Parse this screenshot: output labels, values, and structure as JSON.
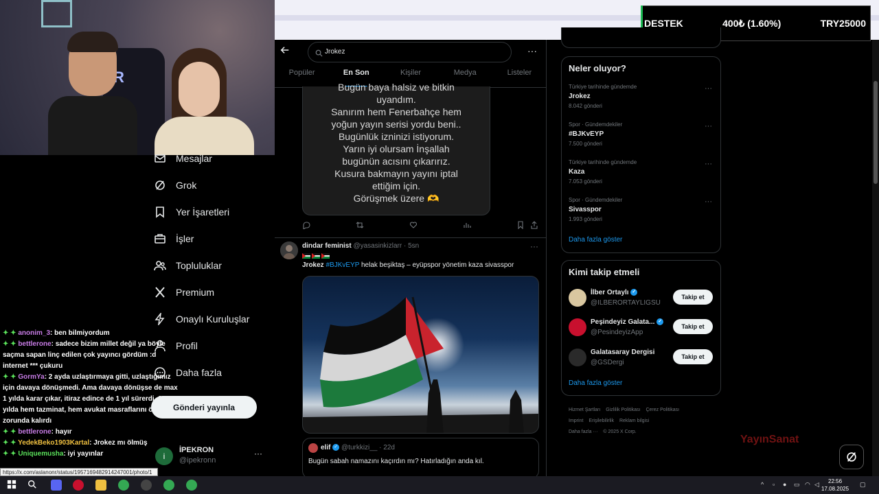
{
  "overlay": {
    "ticker": {
      "label": "DESTEK",
      "change": "400₺ (1.60%)",
      "goal": "TRY25000"
    }
  },
  "chat": {
    "lines": [
      {
        "user": "anonim_3",
        "msg": ": ben bilmiyordum"
      },
      {
        "user": "bettlerone",
        "msg": ": sadece bizim millet değil ya böyle saçma sapan linç edilen çok yayıncı gördüm :d internet *** çukuru"
      },
      {
        "user": "GormYa",
        "msg": ": 2 ayda uzlaştırmaya gitti, uzlaştığımız için davaya dönüşmedi. Ama davaya dönüşse de max 1 yılda karar çıkar, itiraz edince de 1 yıl sürerdi. 2 yılda hem tazminat, hem avukat masraflarını ödemek zorunda kalırdı"
      },
      {
        "user": "bettlerone",
        "msg": ": hayır"
      },
      {
        "user": "YedekBeko1903Kartal",
        "msg": ": Jrokez mı ölmüş"
      },
      {
        "user": "Uniquemusha",
        "msg": ": iyi yayınlar"
      }
    ],
    "link_tooltip": "https://x.com/aslanonr/status/1957169482914247001/photo/1"
  },
  "nav": {
    "items": [
      {
        "label": "Mesajlar",
        "icon": "mail-icon"
      },
      {
        "label": "Grok",
        "icon": "grok-icon"
      },
      {
        "label": "Yer İşaretleri",
        "icon": "bookmark-icon"
      },
      {
        "label": "İşler",
        "icon": "briefcase-icon"
      },
      {
        "label": "Topluluklar",
        "icon": "communities-icon"
      },
      {
        "label": "Premium",
        "icon": "x-logo-icon"
      },
      {
        "label": "Onaylı Kuruluşlar",
        "icon": "lightning-icon"
      },
      {
        "label": "Profil",
        "icon": "person-icon"
      },
      {
        "label": "Daha fazla",
        "icon": "more-circle-icon"
      }
    ],
    "post_button": "Gönderi yayınla",
    "account": {
      "avatar_letter": "i",
      "name": "İPEKRON",
      "handle": "@ipekronn",
      "more": "···"
    }
  },
  "search": {
    "query": "Jrokez",
    "more": "···"
  },
  "tabs": [
    "Popüler",
    "En Son",
    "Kişiler",
    "Medya",
    "Listeler"
  ],
  "tweet1": {
    "image_text_lines": [
      "Bugün baya halsiz ve bitkin",
      "uyandım.",
      "Sanırım hem Fenerbahçe hem",
      "yoğun yayın serisi yordu beni..",
      "Bugünlük izninizi istiyorum.",
      "Yarın iyi olursam İnşallah",
      "bugünün acısını çıkarırız.",
      "Kusura bakmayın yayını iptal",
      "ettiğim için.",
      "Görüşmek üzere 🫶"
    ]
  },
  "tweet2": {
    "name": "dindar feminist",
    "handle": "@yasasinkizlarr · 5sn",
    "mention": "Jrokez",
    "hashtag": "#BJKvEYP",
    "text": " helak beşiktaş – eyüpspor yönetim kaza sivasspor",
    "more": "···",
    "quote": {
      "name": "elif",
      "handle": "@turkkizi__ · 22d",
      "text": "Bugün sabah namazını kaçırdın mı? Hatırladığın anda kıl."
    }
  },
  "trends": {
    "title": "Neler oluyor?",
    "items": [
      {
        "meta": "Türkiye tarihinde gündemde",
        "name": "Jrokez",
        "count": "8.042 gönderi"
      },
      {
        "meta": "Spor · Gündemdekiler",
        "name": "#BJKvEYP",
        "count": "7.500 gönderi"
      },
      {
        "meta": "Türkiye tarihinde gündemde",
        "name": "Kaza",
        "count": "7.053 gönderi"
      },
      {
        "meta": "Spor · Gündemdekiler",
        "name": "Sivasspor",
        "count": "1.993 gönderi"
      }
    ],
    "more_dots": "···",
    "show_more": "Daha fazla göster"
  },
  "who_to_follow": {
    "title": "Kimi takip etmeli",
    "items": [
      {
        "name": "İlber Ortaylı",
        "handle": "@ILBERORTAYLIGSU",
        "button": "Takip et",
        "color": "#d9c7a0"
      },
      {
        "name": "Peşindeyiz Galata...",
        "handle": "@PesindeyizApp",
        "button": "Takip et",
        "color": "#c8102e"
      },
      {
        "name": "Galatasaray Dergisi",
        "handle": "@GSDergi",
        "button": "Takip et",
        "color": "#2a2a2a"
      }
    ],
    "show_more": "Daha fazla göster"
  },
  "footer": {
    "links": [
      "Hizmet Şartları",
      "Gizlilik Politikası",
      "Çerez Politikası",
      "Imprint",
      "Erişilebilirlik",
      "Reklam bilgisi",
      "Daha fazla ···",
      "© 2025 X Corp."
    ]
  },
  "webcam_logo": "R",
  "watermark": "YayınSanat",
  "taskbar": {
    "time": "22:56",
    "date": "17.08.2025"
  }
}
